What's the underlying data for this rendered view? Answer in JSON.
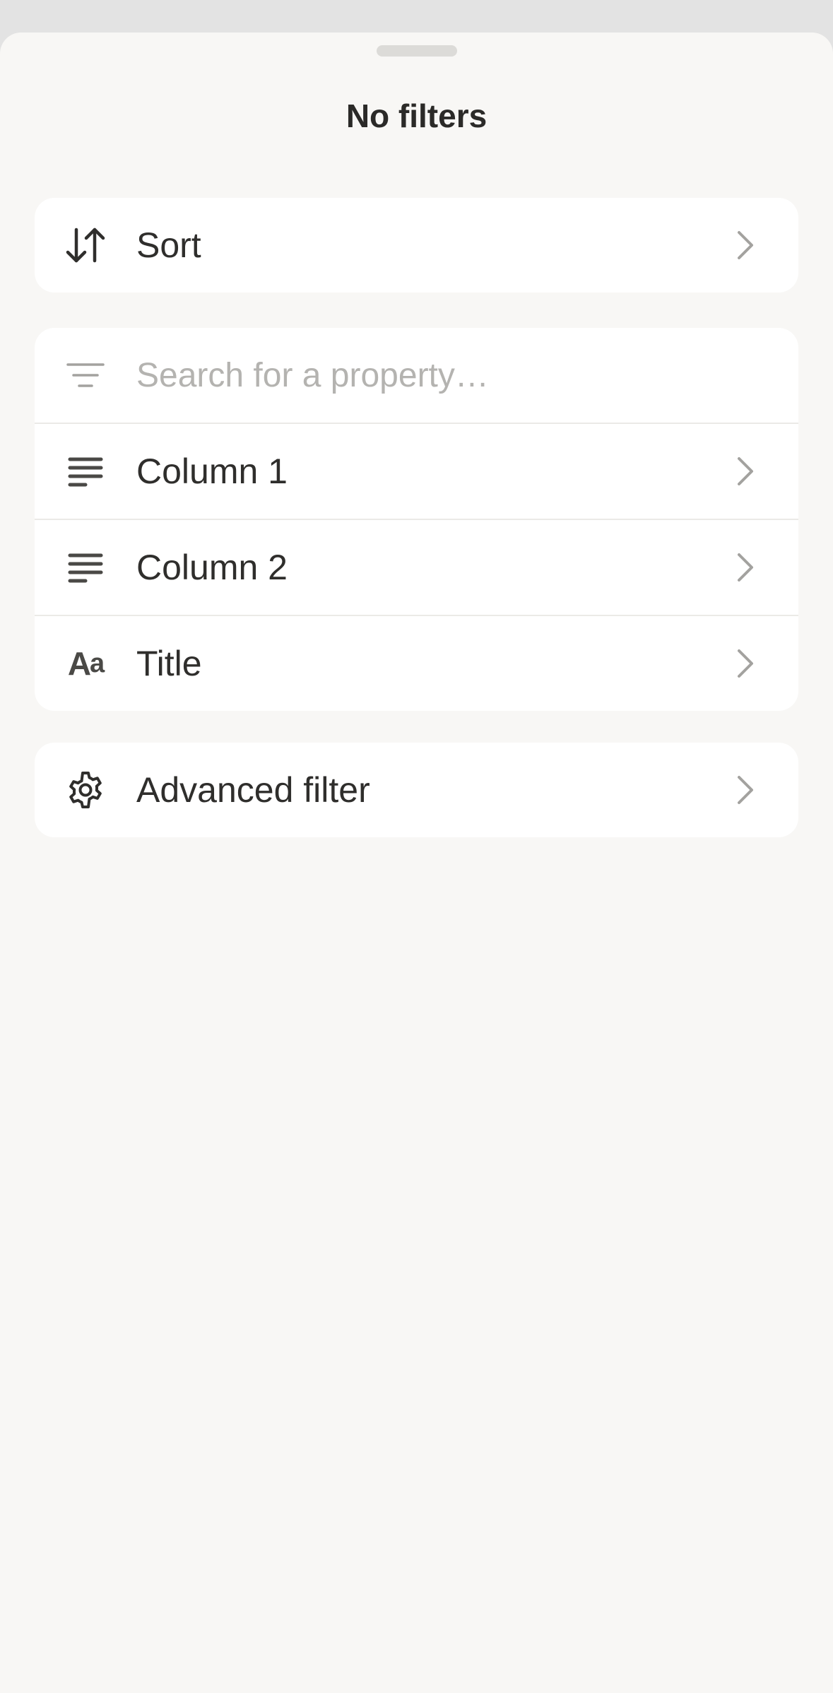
{
  "sheet": {
    "title": "No filters"
  },
  "sort": {
    "icon": "sort-arrows-icon",
    "label": "Sort"
  },
  "search": {
    "icon": "filter-lines-icon",
    "placeholder": "Search for a property…",
    "value": ""
  },
  "properties": [
    {
      "icon": "text-lines-icon",
      "label": "Column 1"
    },
    {
      "icon": "text-lines-icon",
      "label": "Column 2"
    },
    {
      "icon": "title-aa-icon",
      "label": "Title",
      "icon_text_big": "A",
      "icon_text_small": "a"
    }
  ],
  "advanced": {
    "icon": "gear-icon",
    "label": "Advanced filter"
  },
  "colors": {
    "background": "#f8f7f5",
    "card": "#ffffff",
    "text": "#2f2e2c",
    "placeholder": "#b4b3b0",
    "chevron": "#a3a29f"
  }
}
